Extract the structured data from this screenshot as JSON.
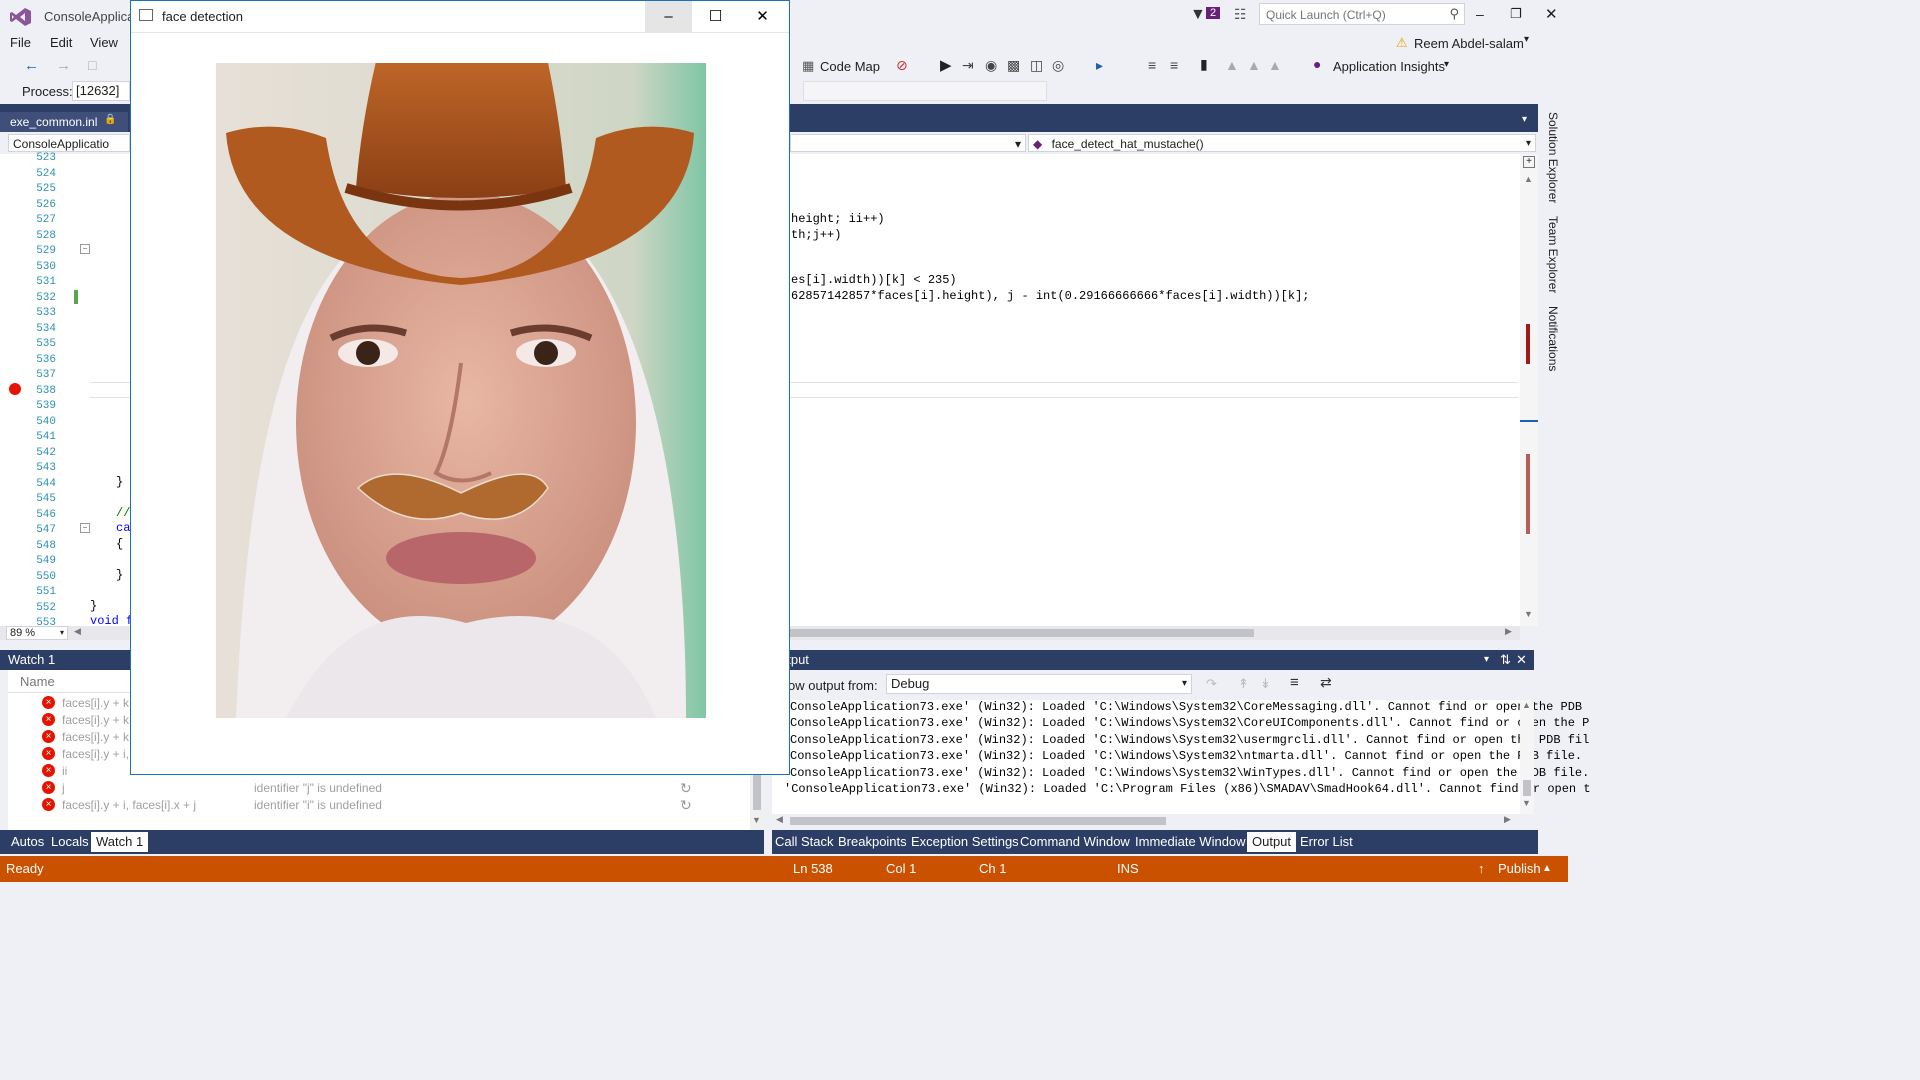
{
  "ide": {
    "app_title": "ConsoleApplica",
    "menu": [
      "File",
      "Edit",
      "View"
    ],
    "notifications_count": "2",
    "quick_launch_placeholder": "Quick Launch (Ctrl+Q)",
    "user_name": "Reem Abdel-salam"
  },
  "toolbar": {
    "code_map": "Code Map",
    "app_insights": "Application Insights",
    "process_label": "Process:",
    "process_value": "[12632] C"
  },
  "editor": {
    "doc_tab": "exe_common.inl",
    "nav_left": "ConsoleApplicatio",
    "nav_right": "face_detect_hat_mustache()",
    "zoom": "89 %",
    "line_numbers": [
      "523",
      "524",
      "525",
      "526",
      "527",
      "528",
      "529",
      "530",
      "531",
      "532",
      "533",
      "534",
      "535",
      "536",
      "537",
      "538",
      "539",
      "540",
      "541",
      "542",
      "543",
      "544",
      "545",
      "546",
      "547",
      "548",
      "549",
      "550",
      "551",
      "552",
      "553"
    ],
    "code_right": [
      "height; ii++)",
      "th;j++)",
      "es[i].width))[k] < 235)",
      "62857142857*faces[i].height), j - int(0.29166666666*faces[i].width))[k];"
    ],
    "code_left": {
      "l544": "}",
      "l546": "//",
      "l547": "ca",
      "l548": "{",
      "l550": "}",
      "l552": "}",
      "l553": "void f"
    }
  },
  "side_tabs": [
    "Solution Explorer",
    "Team Explorer",
    "Notifications"
  ],
  "watch": {
    "title": "Watch 1",
    "name_header": "Name",
    "rows": [
      {
        "name": "faces[i].y + k -",
        "value": ""
      },
      {
        "name": "faces[i].y + k -",
        "value": ""
      },
      {
        "name": "faces[i].y + k -",
        "value": ""
      },
      {
        "name": "faces[i].y + i, f",
        "value": ""
      },
      {
        "name": "ii",
        "value": ""
      },
      {
        "name": "j",
        "value": "identifier \"j\" is undefined"
      },
      {
        "name": "faces[i].y + i, faces[i].x + j",
        "value": "identifier \"i\" is undefined"
      }
    ],
    "tabs": [
      "Autos",
      "Locals",
      "Watch 1"
    ]
  },
  "output": {
    "title": "utput",
    "show_from_label": "ow output from:",
    "show_from_value": "Debug",
    "lines": [
      "ConsoleApplication73.exe' (Win32): Loaded 'C:\\Windows\\System32\\CoreMessaging.dll'. Cannot find or open the PDB",
      "ConsoleApplication73.exe' (Win32): Loaded 'C:\\Windows\\System32\\CoreUIComponents.dll'. Cannot find or open the P",
      "ConsoleApplication73.exe' (Win32): Loaded 'C:\\Windows\\System32\\usermgrcli.dll'. Cannot find or open the PDB fil",
      "ConsoleApplication73.exe' (Win32): Loaded 'C:\\Windows\\System32\\ntmarta.dll'. Cannot find or open the PDB file.",
      "ConsoleApplication73.exe' (Win32): Loaded 'C:\\Windows\\System32\\WinTypes.dll'. Cannot find or open the PDB file.",
      "'ConsoleApplication73.exe' (Win32): Loaded 'C:\\Program Files (x86)\\SMADAV\\SmadHook64.dll'. Cannot find or open t"
    ],
    "tabs": [
      "Call Stack",
      "Breakpoints",
      "Exception Settings",
      "Command Window",
      "Immediate Window",
      "Output",
      "Error List"
    ]
  },
  "status": {
    "ready": "Ready",
    "ln": "Ln 538",
    "col": "Col 1",
    "ch": "Ch 1",
    "ins": "INS",
    "publish": "Publish"
  },
  "face_window": {
    "title": "face detection"
  },
  "colors": {
    "ide_background": "#eef0f5",
    "panel_header": "#2d3e66",
    "status_bar": "#ca5100",
    "line_number": "#2b91af",
    "error_red": "#e51400"
  }
}
